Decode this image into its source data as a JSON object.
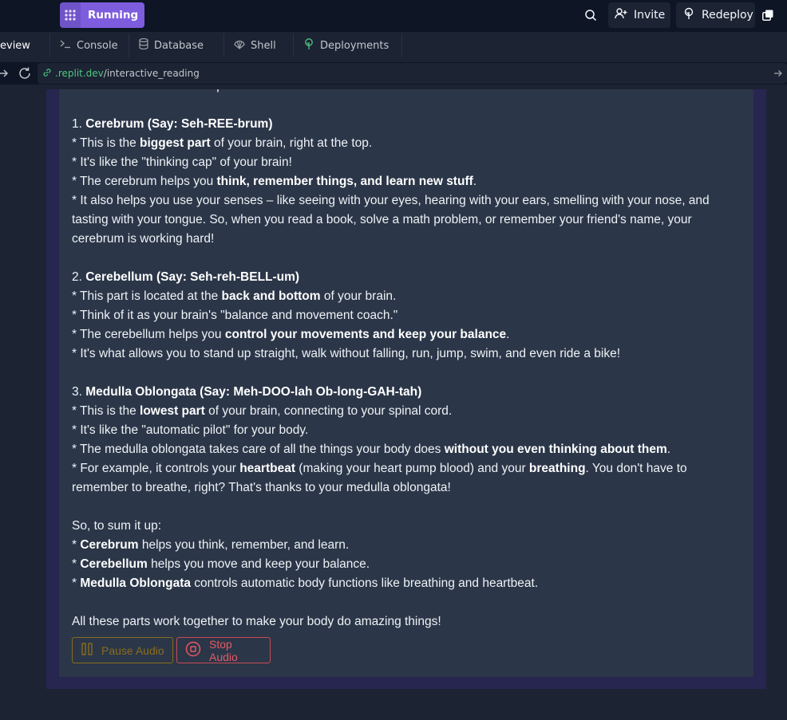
{
  "topbar": {
    "run_label": "Running",
    "invite_label": "Invite",
    "redeploy_label": "Redeploy",
    "accent": "#7d5dde"
  },
  "tabs": [
    {
      "label": "eview",
      "icon": "none"
    },
    {
      "label": "Console",
      "icon": "terminal-icon"
    },
    {
      "label": "Database",
      "icon": "database-icon"
    },
    {
      "label": "Shell",
      "icon": "shell-icon"
    },
    {
      "label": "Deployments",
      "icon": "deployments-icon"
    }
  ],
  "url": {
    "domain": ".replit.dev",
    "path": "/interactive_reading"
  },
  "reading": {
    "intro": "Your brain has three main parts:",
    "s1_num": "1. ",
    "s1_title": "Cerebrum (Say: Seh-REE-brum)",
    "s1_l1_a": "* This is the ",
    "s1_l1_b": "biggest part",
    "s1_l1_c": " of your brain, right at the top.",
    "s1_l2": "* It's like the \"thinking cap\" of your brain!",
    "s1_l3_a": "* The cerebrum helps you ",
    "s1_l3_b": "think, remember things, and learn new stuff",
    "s1_l3_c": ".",
    "s1_l4": "* It also helps you use your senses – like seeing with your eyes, hearing with your ears, smelling with your nose, and tasting with your tongue. So, when you read a book, solve a math problem, or remember your friend's name, your cerebrum is working hard!",
    "s2_num": "2. ",
    "s2_title": "Cerebellum (Say: Seh-reh-BELL-um)",
    "s2_l1_a": "* This part is located at the ",
    "s2_l1_b": "back and bottom",
    "s2_l1_c": " of your brain.",
    "s2_l2": "* Think of it as your brain's \"balance and movement coach.\"",
    "s2_l3_a": "* The cerebellum helps you ",
    "s2_l3_b": "control your movements and keep your balance",
    "s2_l3_c": ".",
    "s2_l4": "* It's what allows you to stand up straight, walk without falling, run, jump, swim, and even ride a bike!",
    "s3_num": "3. ",
    "s3_title": "Medulla Oblongata (Say: Meh-DOO-lah Ob-long-GAH-tah)",
    "s3_l1_a": "* This is the ",
    "s3_l1_b": "lowest part",
    "s3_l1_c": " of your brain, connecting to your spinal cord.",
    "s3_l2": "* It's like the \"automatic pilot\" for your body.",
    "s3_l3_a": "* The medulla oblongata takes care of all the things your body does ",
    "s3_l3_b": "without you even thinking about them",
    "s3_l3_c": ".",
    "s3_l4_a": "* For example, it controls your ",
    "s3_l4_b": "heartbeat",
    "s3_l4_c": " (making your heart pump blood) and your ",
    "s3_l4_d": "breathing",
    "s3_l4_e": ". You don't have to remember to breathe, right? That's thanks to your medulla oblongata!",
    "sum_intro": "So, to sum it up:",
    "sum1_a": "* ",
    "sum1_b": "Cerebrum",
    "sum1_c": " helps you think, remember, and learn.",
    "sum2_a": "* ",
    "sum2_b": "Cerebellum",
    "sum2_c": " helps you move and keep your balance.",
    "sum3_a": "* ",
    "sum3_b": "Medulla Oblongata",
    "sum3_c": " controls automatic body functions like breathing and heartbeat.",
    "closing": "All these parts work together to make your body do amazing things!"
  },
  "controls": {
    "pause_label": "Pause Audio",
    "stop_label": "Stop Audio",
    "pause_color": "#8a6d1c",
    "stop_color": "#e55a64"
  }
}
